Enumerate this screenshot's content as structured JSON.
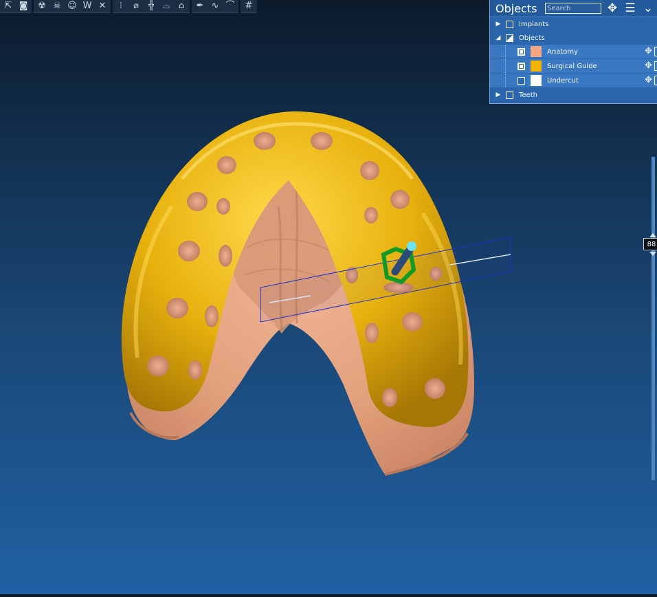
{
  "toolbar": {
    "groups": [
      {
        "icons": [
          "cursor-icon",
          "camera-icon"
        ]
      },
      {
        "icons": [
          "radiation-icon",
          "skull-icon",
          "face-icon",
          "tooth-icon",
          "close-icon"
        ]
      },
      {
        "icons": [
          "implant-icon",
          "guide-icon",
          "teeth-icon",
          "arch-icon",
          "gum-icon"
        ]
      },
      {
        "icons": [
          "pen-icon",
          "curve-icon",
          "spline-icon"
        ]
      },
      {
        "icons": [
          "grid-icon"
        ]
      }
    ]
  },
  "objects_panel": {
    "title": "Objects",
    "search_placeholder": "Search",
    "header_icons": [
      "move-icon",
      "list-icon",
      "chevron-down-icon"
    ],
    "rows": [
      {
        "label": "Implants",
        "expanded": false,
        "checked": false
      },
      {
        "label": "Objects",
        "expanded": true,
        "checked": "partial",
        "children": [
          {
            "label": "Anatomy",
            "checked": true,
            "color": "#f4a582"
          },
          {
            "label": "Surgical Guide",
            "checked": true,
            "color": "#f0b400"
          },
          {
            "label": "Undercut",
            "checked": false,
            "color": "#ffffff"
          }
        ]
      },
      {
        "label": "Teeth",
        "expanded": false,
        "checked": false
      }
    ]
  },
  "viewport": {
    "colors": {
      "anatomy": "#e8a37d",
      "guide": "#e9b50e",
      "implant_ring": "#119a27",
      "implant_tip": "#6fe3f2",
      "plane": "#1a33c8"
    }
  },
  "slider": {
    "value": "88"
  }
}
